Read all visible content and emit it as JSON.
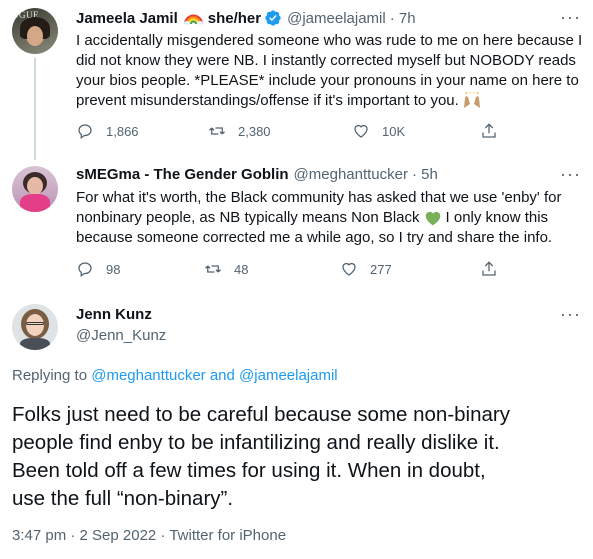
{
  "tweets": [
    {
      "name": "Jameela Jamil",
      "pronouns": "she/her",
      "handle": "@jameelajamil",
      "time": "· 7h",
      "avatar_badge_text": "OGUE",
      "text_lines": [
        "I accidentally misgendered someone who was rude to me on here because I",
        "did not know they were NB. I instantly corrected myself but NOBODY reads",
        "your bios people. *PLEASE* include your pronouns in your name on here to",
        "prevent misunderstandings/offense if it's important to you."
      ],
      "replies": "1,866",
      "retweets": "2,380",
      "likes": "10K"
    },
    {
      "name": "sMEGma - The Gender Goblin",
      "handle": "@meghanttucker",
      "time": "· 5h",
      "text_lines": [
        "For what it's worth, the Black community has asked that we use 'enby' for",
        "nonbinary people, as NB typically means Non Black",
        "I only know this",
        "because someone corrected me a while ago, so I try and share the info."
      ],
      "replies": "98",
      "retweets": "48",
      "likes": "277"
    }
  ],
  "main": {
    "name": "Jenn Kunz",
    "handle": "@Jenn_Kunz",
    "replying_prefix": "Replying to",
    "replying_to": [
      "@meghanttucker",
      "and",
      "@jameelajamil"
    ],
    "text_lines": [
      "Folks just need to be careful because some non-binary",
      "people find enby to be infantilizing and really dislike it.",
      "Been told off a few times for using it. When in doubt,",
      "use the full “non-binary”."
    ],
    "timestamp": "3:47 pm · 2 Sep 2022 · Twitter for iPhone"
  },
  "more_label": "···",
  "colors": {
    "accent": "#1d9bf0",
    "text": "#0f1419",
    "muted": "#536471",
    "verified": "#1d9bf0",
    "heart_emoji": "#78b159"
  },
  "icons": [
    "reply-icon",
    "retweet-icon",
    "like-icon",
    "share-icon",
    "verified-icon",
    "rainbow-icon",
    "heart-emoji-icon",
    "raised-hands-icon",
    "more-icon"
  ]
}
